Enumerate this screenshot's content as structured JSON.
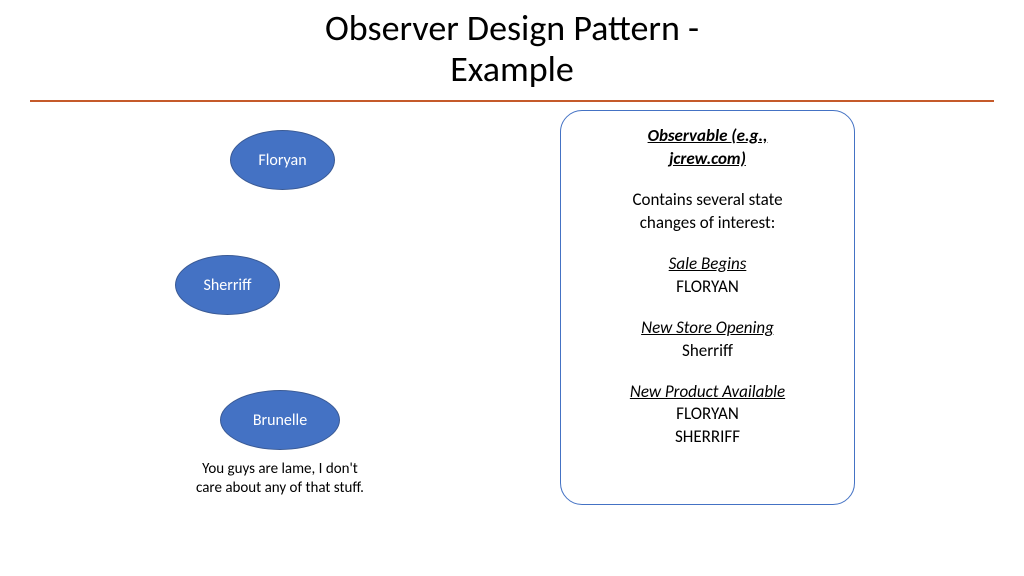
{
  "title": {
    "line1": "Observer Design Pattern -",
    "line2": "Example"
  },
  "observers": {
    "o1": "Floryan",
    "o2": "Sherriff",
    "o3": "Brunelle"
  },
  "caption": {
    "line1": "You guys are lame, I don't",
    "line2": "care about any of that stuff."
  },
  "panel": {
    "heading_l1": "Observable (e.g.,",
    "heading_l2": "jcrew.com)",
    "intro_l1": "Contains several state",
    "intro_l2": "changes of interest:",
    "s1_h": "Sale Begins",
    "s1_v1": "FLORYAN",
    "s2_h": "New Store Opening",
    "s2_v1": "Sherriff",
    "s3_h": "New Product Available",
    "s3_v1": "FLORYAN",
    "s3_v2": "SHERRIFF"
  }
}
